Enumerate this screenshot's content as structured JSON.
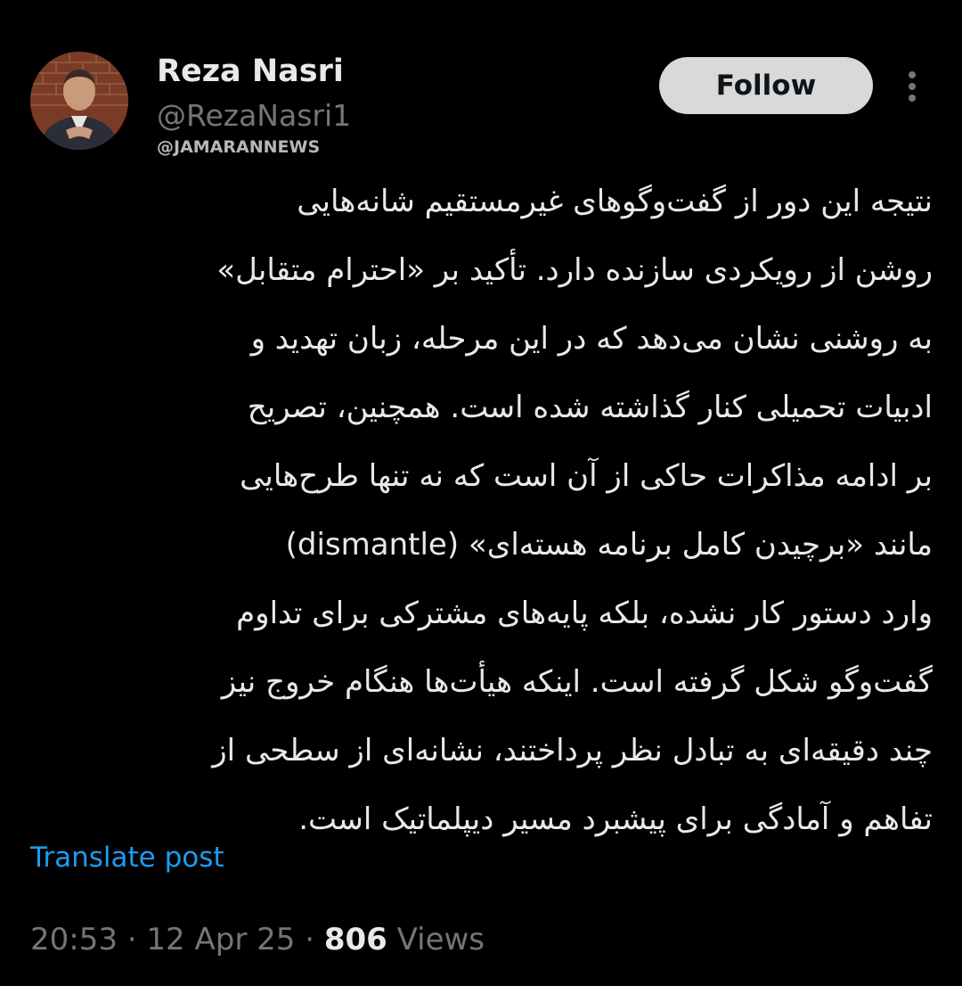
{
  "user": {
    "display_name": "Reza Nasri",
    "handle": "@RezaNasri1",
    "avatar_icon": "profile-photo"
  },
  "watermark": "@JAMARANNEWS",
  "follow_button": {
    "label": "Follow"
  },
  "more_icon": "vertical-ellipsis-icon",
  "tweet": {
    "lines": [
      "نتیجه این دور از گفت‌وگوهای غیرمستقیم شانه‌هایی",
      "روشن از رویکردی سازنده دارد. تأکید بر «احترام متقابل»",
      "به روشنی نشان می‌دهد که در این مرحله، زبان تهدید و",
      "ادبیات تحمیلی کنار گذاشته شده است. همچنین، تصریح",
      "بر ادامه مذاکرات حاکی از آن است که نه تنها طرح‌هایی",
      "مانند «برچیدن کامل برنامه هسته‌ای» (dismantle)",
      "وارد دستور کار نشده، بلکه پایه‌های مشترکی برای تداوم",
      "گفت‌وگو شکل گرفته است. اینکه هیأت‌ها هنگام خروج نیز",
      "چند دقیقه‌ای به تبادل نظر پرداختند، نشانه‌ای از سطحی از",
      "تفاهم و آمادگی برای پیشبرد مسیر دیپلماتیک است."
    ]
  },
  "translate_link": "Translate post",
  "meta": {
    "time": "20:53",
    "separator": " · ",
    "date": "12 Apr 25",
    "views_count": "806",
    "views_label": " Views"
  },
  "colors": {
    "background": "#000000",
    "text": "#e7e9ea",
    "secondary": "#71767b",
    "link": "#1d9bf0",
    "follow_bg": "#d9d9d9"
  }
}
